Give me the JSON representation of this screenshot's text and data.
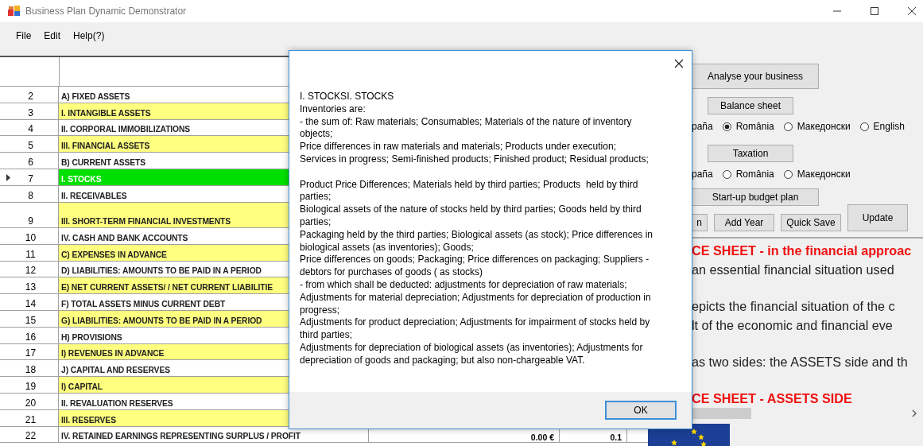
{
  "window": {
    "title": "Business Plan Dynamic Demonstrator"
  },
  "menu": [
    "File",
    "Edit",
    "Help(?)"
  ],
  "grid": {
    "rows": [
      {
        "number": "2",
        "name": "A) FIXED ASSETS",
        "highlighted": false,
        "selected": false,
        "tall": false
      },
      {
        "number": "3",
        "name": "I. INTANGIBLE ASSETS",
        "highlighted": true,
        "selected": false,
        "tall": false
      },
      {
        "number": "4",
        "name": "II. CORPORAL IMMOBILIZATIONS",
        "highlighted": false,
        "selected": false,
        "tall": false
      },
      {
        "number": "5",
        "name": "III. FINANCIAL ASSETS",
        "highlighted": true,
        "selected": false,
        "tall": false
      },
      {
        "number": "6",
        "name": "B) CURRENT ASSETS",
        "highlighted": false,
        "selected": false,
        "tall": false
      },
      {
        "number": "7",
        "name": "I. STOCKS",
        "highlighted": false,
        "selected": true,
        "tall": false
      },
      {
        "number": "8",
        "name": "II. RECEIVABLES",
        "highlighted": false,
        "selected": false,
        "tall": false
      },
      {
        "number": "9",
        "name": "III. SHORT-TERM FINANCIAL INVESTMENTS",
        "highlighted": true,
        "selected": false,
        "tall": true
      },
      {
        "number": "10",
        "name": "IV. CASH AND BANK ACCOUNTS",
        "highlighted": false,
        "selected": false,
        "tall": false
      },
      {
        "number": "11",
        "name": "C) EXPENSES IN ADVANCE",
        "highlighted": true,
        "selected": false,
        "tall": false
      },
      {
        "number": "12",
        "name": "D) LIABILITIES: AMOUNTS TO BE PAID IN A PERIOD",
        "highlighted": false,
        "selected": false,
        "tall": false
      },
      {
        "number": "13",
        "name": "E) NET CURRENT ASSETS/ / NET CURRENT LIABILITIE",
        "highlighted": true,
        "selected": false,
        "tall": false
      },
      {
        "number": "14",
        "name": "F) TOTAL ASSETS MINUS CURRENT DEBT",
        "highlighted": false,
        "selected": false,
        "tall": false
      },
      {
        "number": "15",
        "name": "G) LIABILITIES: AMOUNTS TO BE PAID IN A PERIOD",
        "highlighted": true,
        "selected": false,
        "tall": false
      },
      {
        "number": "16",
        "name": "H) PROVISIONS",
        "highlighted": false,
        "selected": false,
        "tall": false
      },
      {
        "number": "17",
        "name": "I) REVENUES IN ADVANCE",
        "highlighted": true,
        "selected": false,
        "tall": false
      },
      {
        "number": "18",
        "name": "J) CAPITAL AND RESERVES",
        "highlighted": false,
        "selected": false,
        "tall": false
      },
      {
        "number": "19",
        "name": "I) CAPITAL",
        "highlighted": true,
        "selected": false,
        "tall": false
      },
      {
        "number": "20",
        "name": "II. REVALUATION RESERVES",
        "highlighted": false,
        "selected": false,
        "tall": false
      },
      {
        "number": "21",
        "name": "III. RESERVES",
        "highlighted": true,
        "selected": false,
        "tall": false
      },
      {
        "number": "22",
        "name": "IV. RETAINED EARNINGS REPRESENTING SURPLUS / PROFIT",
        "highlighted": false,
        "selected": false,
        "tall": false,
        "value": "0.00 €",
        "column_3": "0.1"
      }
    ]
  },
  "panel": {
    "analyse_button": "Analyse your business",
    "balance_button": "Balance sheet",
    "balance_languages": [
      {
        "label": "paña",
        "kind": "label"
      },
      {
        "label": "România",
        "kind": "radio",
        "selected": true
      },
      {
        "label": "Македонски",
        "kind": "radio",
        "selected": false
      },
      {
        "label": "English",
        "kind": "radio",
        "selected": false
      }
    ],
    "taxation_button": "Taxation",
    "taxation_languages": [
      {
        "label": "paña",
        "kind": "label"
      },
      {
        "label": "România",
        "kind": "radio",
        "selected": false
      },
      {
        "label": "Македонски",
        "kind": "radio",
        "selected": false
      }
    ],
    "startup_button": "Start-up budget plan",
    "actions": [
      "n",
      "Add Year",
      "Quick Save"
    ],
    "update_button": "Update",
    "document": [
      {
        "kind": "heading",
        "lines": [
          "CE SHEET - in the financial approac"
        ]
      },
      {
        "kind": "text",
        "lines": [
          "an essential financial situation used"
        ]
      },
      {
        "kind": "text",
        "lines": [
          "epicts the financial situation of the c",
          "lt of the economic and financial eve"
        ]
      },
      {
        "kind": "text",
        "lines": [
          "as two sides: the ASSETS side and th"
        ]
      },
      {
        "kind": "heading",
        "lines": [
          "CE SHEET - ASSETS SIDE"
        ]
      }
    ]
  },
  "dialog": {
    "message": "I. STOCKSI. STOCKS\nInventories are:\n- the sum of: Raw materials; Consumables; Materials of the nature of inventory objects;\nPrice differences in raw materials and materials; Products under execution;\nServices in progress; Semi-finished products; Finished product; Residual products;\n\nProduct Price Differences; Materials held by third parties; Products  held by third parties;\nBiological assets of the nature of stocks held by third parties; Goods held by third parties;\nPackaging held by the third parties; Biological assets (as stock); Price differences in biological assets (as inventories); Goods;\nPrice differences on goods; Packaging; Price differences on packaging; Suppliers - debtors for purchases of goods ( as stocks)\n- from which shall be deducted: adjustments for depreciation of raw materials;\nAdjustments for material depreciation; Adjustments for depreciation of production in progress;\nAdjustments for product depreciation; Adjustments for impairment of stocks held by third parties;\nAdjustments for depreciation of biological assets (as inventories); Adjustments for depreciation of goods and packaging; but also non-chargeable VAT.",
    "ok_button": "OK"
  }
}
